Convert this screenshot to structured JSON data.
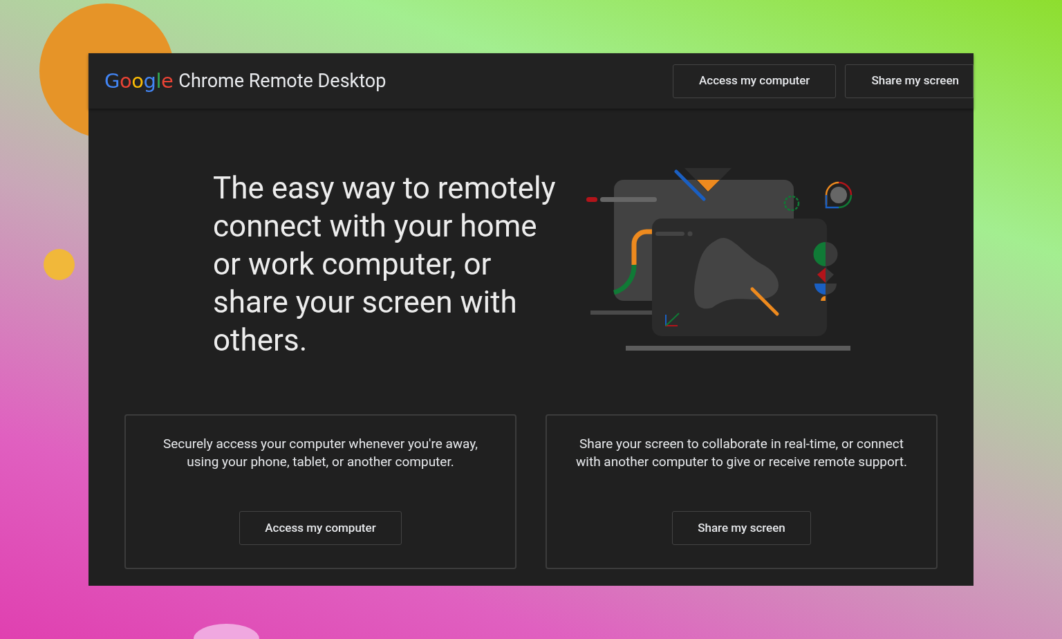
{
  "header": {
    "logo": "Google",
    "product": "Chrome Remote Desktop",
    "buttons": [
      "Access my computer",
      "Share my screen"
    ]
  },
  "hero": {
    "headline": "The easy way to remotely connect with your home or work computer, or share your screen with others."
  },
  "cards": [
    {
      "description": "Securely access your computer whenever you're away, using your phone, tablet, or another computer.",
      "button": "Access my computer"
    },
    {
      "description": "Share your screen to collaborate in real-time, or connect with another computer to give or receive remote support.",
      "button": "Share my screen"
    }
  ]
}
